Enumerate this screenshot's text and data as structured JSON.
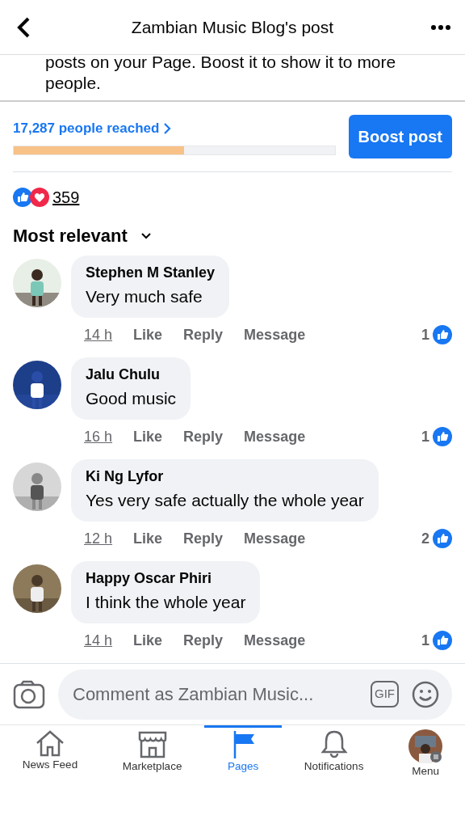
{
  "header": {
    "title": "Zambian Music Blog's post"
  },
  "notice": {
    "lines": [
      "posts on your Page. Boost it to show it to more",
      "people."
    ]
  },
  "reach": {
    "label": "17,287 people reached",
    "level": 0.53,
    "button": "Boost post"
  },
  "reactions": {
    "count": "359"
  },
  "sort": {
    "label": "Most relevant"
  },
  "comments": [
    {
      "author": "Stephen M Stanley",
      "text": "Very much safe",
      "time": "14 h",
      "actions": [
        "Like",
        "Reply",
        "Message"
      ],
      "likes": "1"
    },
    {
      "author": "Jalu Chulu",
      "text": "Good music",
      "time": "16 h",
      "actions": [
        "Like",
        "Reply",
        "Message"
      ],
      "likes": "1"
    },
    {
      "author": "Ki Ng Lyfor",
      "text": "Yes very safe actually the whole year",
      "time": "12 h",
      "actions": [
        "Like",
        "Reply",
        "Message"
      ],
      "likes": "2"
    },
    {
      "author": "Happy Oscar Phiri",
      "text": "I think the whole year",
      "time": "14 h",
      "actions": [
        "Like",
        "Reply",
        "Message"
      ],
      "likes": "1"
    }
  ],
  "composer": {
    "placeholder": "Comment as Zambian Music...",
    "gif": "GIF"
  },
  "tabs": [
    {
      "label": "News Feed",
      "selected": false
    },
    {
      "label": "Marketplace",
      "selected": false
    },
    {
      "label": "Pages",
      "selected": true
    },
    {
      "label": "Notifications",
      "selected": false
    },
    {
      "label": "Menu",
      "selected": false
    }
  ]
}
